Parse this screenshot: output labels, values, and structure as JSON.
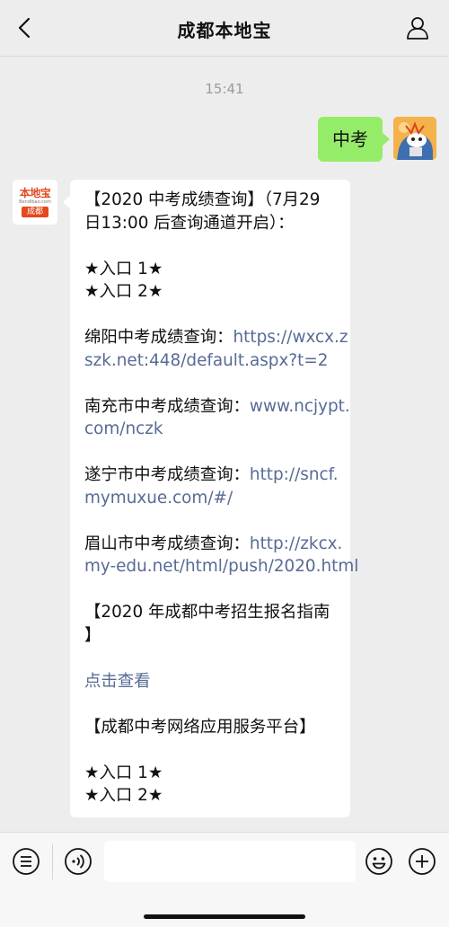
{
  "header": {
    "title": "成都本地宝",
    "back_icon": "chevron-left-icon",
    "profile_icon": "person-icon"
  },
  "chat": {
    "timestamp": "15:41",
    "sent": {
      "text": "中考"
    },
    "received": {
      "avatar": {
        "logo_text": "本地宝",
        "logo_sub": "Bendibao.com",
        "logo_city": "成都"
      },
      "lines": [
        {
          "text": "【2020 中考成绩查询】（7月29"
        },
        {
          "text": "日13:00 后查询通道开启）："
        },
        {
          "gap": true
        },
        {
          "text": "★入口 1★"
        },
        {
          "text": "★入口 2★"
        },
        {
          "gap": true
        },
        {
          "label": "绵阳中考成绩查询：",
          "link": "https://wxcx.z"
        },
        {
          "link": "szk.net:448/default.aspx?t=2"
        },
        {
          "gap": true
        },
        {
          "label": "南充市中考成绩查询：",
          "link": "www.ncjypt."
        },
        {
          "link": "com/nczk"
        },
        {
          "gap": true
        },
        {
          "label": "遂宁市中考成绩查询：",
          "link": "http://sncf."
        },
        {
          "link": "mymuxue.com/#/"
        },
        {
          "gap": true
        },
        {
          "label": "眉山市中考成绩查询：",
          "link": "http://zkcx."
        },
        {
          "link": "my-edu.net/html/push/2020.html"
        },
        {
          "gap": true
        },
        {
          "text": "【2020 年成都中考招生报名指南"
        },
        {
          "text": "】"
        },
        {
          "gap": true
        },
        {
          "link": "点击查看"
        },
        {
          "gap": true
        },
        {
          "text": "【成都中考网络应用服务平台】"
        },
        {
          "gap": true
        },
        {
          "text": "★入口 1★"
        },
        {
          "text": "★入口 2★"
        }
      ]
    }
  },
  "input_bar": {
    "menu_icon": "menu-list-icon",
    "voice_icon": "voice-icon",
    "emoji_icon": "emoji-icon",
    "add_icon": "plus-icon",
    "input_value": ""
  },
  "colors": {
    "background": "#ededed",
    "sent_bubble": "#95ec69",
    "link": "#576b95",
    "brand": "#e4491f"
  }
}
